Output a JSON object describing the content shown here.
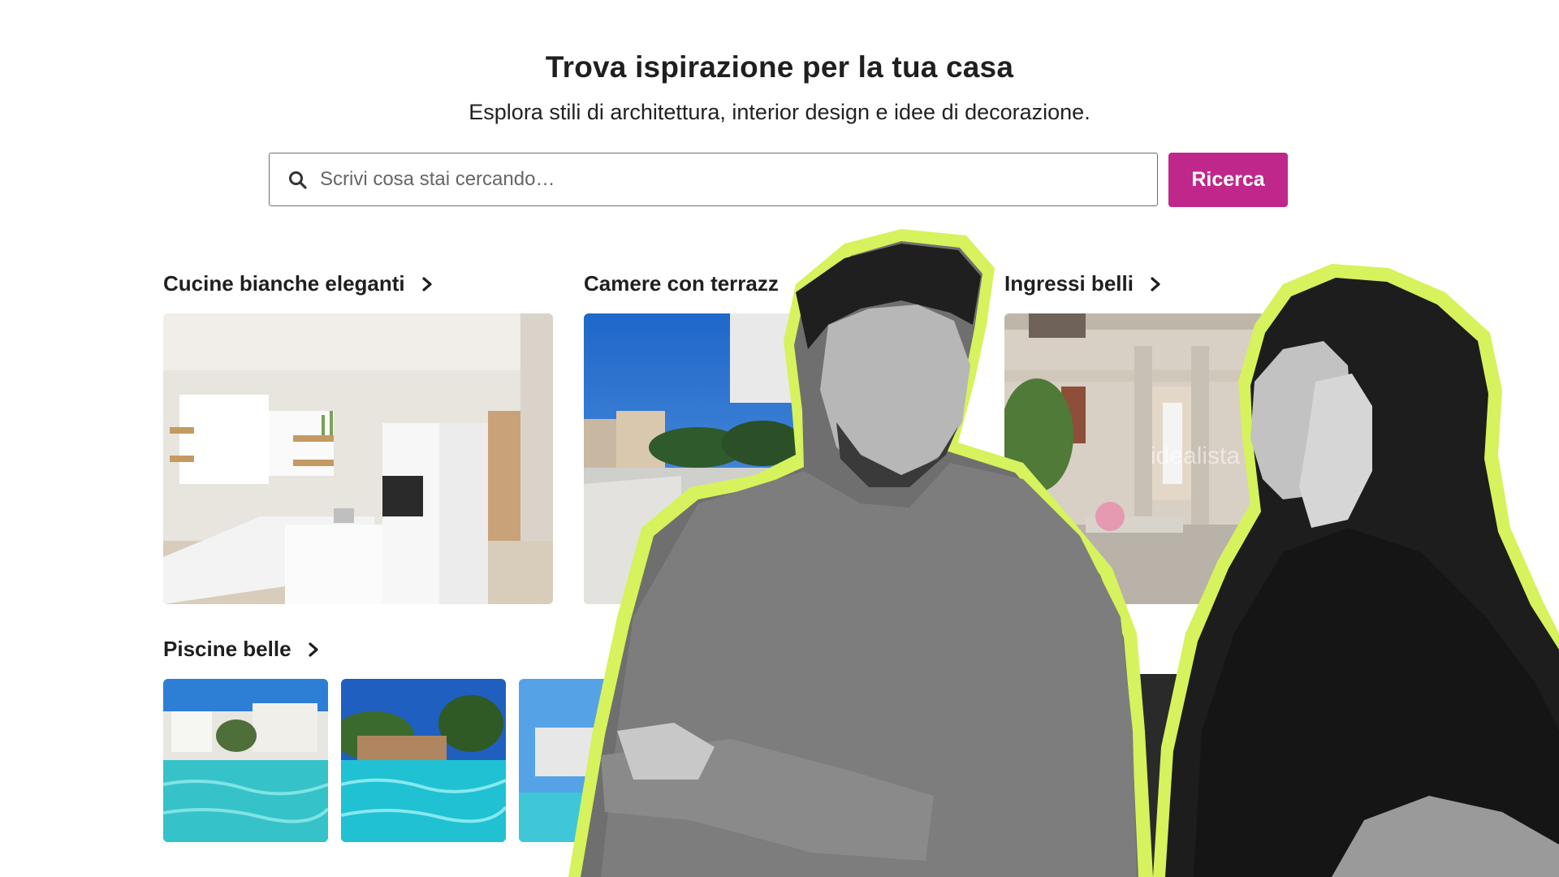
{
  "header": {
    "title": "Trova ispirazione per la tua casa",
    "subtitle": "Esplora stili di architettura, interior design e idee di decorazione."
  },
  "search": {
    "placeholder": "Scrivi cosa stai cercando…",
    "button_label": "Ricerca"
  },
  "categories": [
    {
      "label": "Cucine bianche eleganti",
      "icon": "chevron-right-icon"
    },
    {
      "label": "Camere con terrazz",
      "icon": "chevron-right-icon"
    },
    {
      "label": "Ingressi belli",
      "icon": "chevron-right-icon"
    },
    {
      "label": "Piscine belle",
      "icon": "chevron-right-icon"
    }
  ],
  "watermark": "idealista",
  "colors": {
    "accent": "#c0278b",
    "outline_highlight": "#d4f25c"
  }
}
